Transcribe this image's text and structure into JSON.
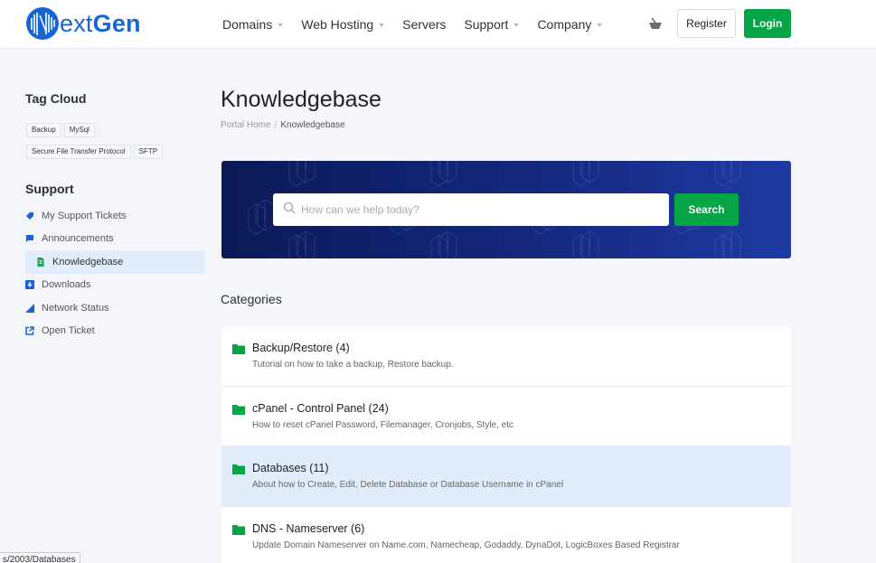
{
  "header": {
    "logo": {
      "text_light": "ext",
      "text_bold": "Gen",
      "mark": "N",
      "brand_color": "#1565d8"
    },
    "nav": [
      {
        "label": "Domains",
        "has_dropdown": true
      },
      {
        "label": "Web Hosting",
        "has_dropdown": true
      },
      {
        "label": "Servers",
        "has_dropdown": false
      },
      {
        "label": "Support",
        "has_dropdown": true
      },
      {
        "label": "Company",
        "has_dropdown": true
      }
    ],
    "cart_icon": "shopping-basket-icon",
    "register_label": "Register",
    "login_label": "Login"
  },
  "sidebar": {
    "tag_cloud_heading": "Tag Cloud",
    "tags": [
      "Backup",
      "MySql",
      "Secure File Transfer Protocol",
      "SFTP"
    ],
    "support_heading": "Support",
    "items": [
      {
        "label": "My Support Tickets",
        "icon": "ticket-icon",
        "active": false
      },
      {
        "label": "Announcements",
        "icon": "comment-icon",
        "active": false
      },
      {
        "label": "Knowledgebase",
        "icon": "file-icon",
        "active": true
      },
      {
        "label": "Downloads",
        "icon": "download-icon",
        "active": false
      },
      {
        "label": "Network Status",
        "icon": "signal-icon",
        "active": false
      },
      {
        "label": "Open Ticket",
        "icon": "external-link-icon",
        "active": false
      }
    ]
  },
  "main": {
    "title": "Knowledgebase",
    "breadcrumb": [
      {
        "label": "Portal Home",
        "link": true
      },
      {
        "label": "Knowledgebase",
        "link": false
      }
    ],
    "search": {
      "placeholder": "How can we help today?",
      "value": "",
      "button_label": "Search"
    },
    "categories_heading": "Categories",
    "categories": [
      {
        "title": "Backup/Restore (4)",
        "description": "Tutorial on how to take a backup, Restore backup.",
        "hovered": false
      },
      {
        "title": "cPanel - Control Panel (24)",
        "description": "How to reset cPanel Password, Filemanager, Cronjobs, Style, etc",
        "hovered": false
      },
      {
        "title": "Databases (11)",
        "description": "About how to Create, Edit, Delete Database or Database Username in cPanel",
        "hovered": true
      },
      {
        "title": "DNS - Nameserver (6)",
        "description": "Update Domain Nameserver on Name.com, Namecheap, Godaddy, DynaDot, LogicBoxes Based Registrar",
        "hovered": false
      }
    ]
  },
  "status_bar": {
    "url_text": "s/2003/Databases"
  },
  "colors": {
    "accent_green": "#04a447",
    "brand_blue": "#1565d8",
    "active_bg": "#e1edfc",
    "page_bg": "#f4f6f9"
  }
}
